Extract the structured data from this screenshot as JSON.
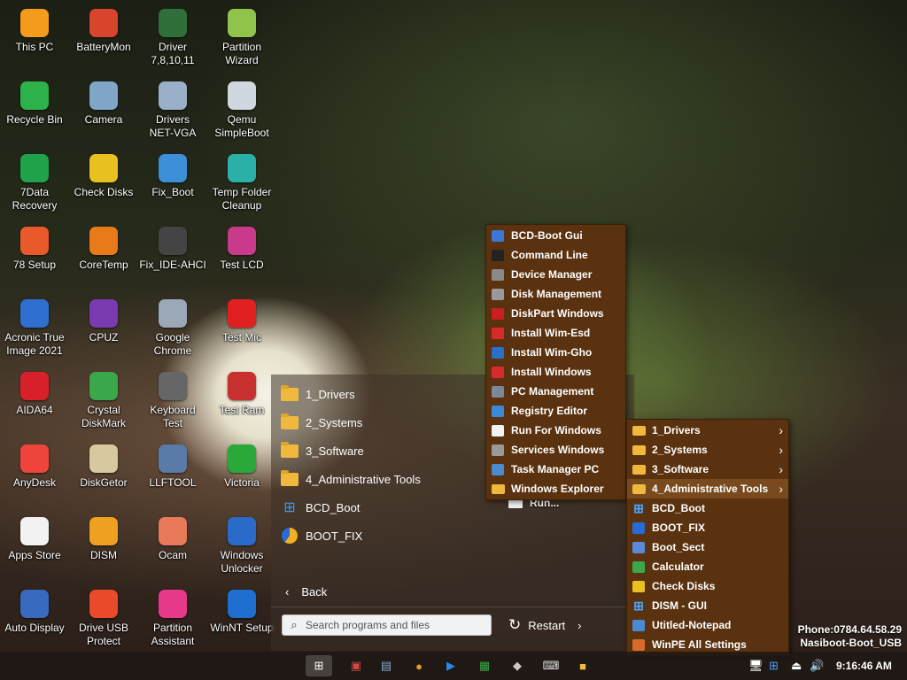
{
  "desktop_icons": [
    {
      "label": "This PC",
      "icon": "this-pc-icon",
      "color": "#f59b1c"
    },
    {
      "label": "BatteryMon",
      "icon": "battery-icon",
      "color": "#d8442c"
    },
    {
      "label": "Driver\n7,8,10,11",
      "icon": "driver-icon",
      "color": "#2f6f3a"
    },
    {
      "label": "Partition\nWizard",
      "icon": "partition-wizard-icon",
      "color": "#8fc34a"
    },
    {
      "label": "Recycle Bin",
      "icon": "recycle-bin-icon",
      "color": "#2db14a"
    },
    {
      "label": "Camera",
      "icon": "camera-icon",
      "color": "#7fa6c8"
    },
    {
      "label": "Drivers\nNET-VGA",
      "icon": "drivers-net-icon",
      "color": "#9ab0c8"
    },
    {
      "label": "Qemu\nSimpleBoot",
      "icon": "qemu-icon",
      "color": "#cfd8e0"
    },
    {
      "label": "7Data\nRecovery",
      "icon": "data-recovery-icon",
      "color": "#1fa24a"
    },
    {
      "label": "Check Disks",
      "icon": "check-disks-icon",
      "color": "#e8c020"
    },
    {
      "label": "Fix_Boot",
      "icon": "fix-boot-icon",
      "color": "#3d8fd8"
    },
    {
      "label": "Temp Folder\nCleanup",
      "icon": "broom-icon",
      "color": "#2bb0a8"
    },
    {
      "label": "78 Setup",
      "icon": "setup-icon",
      "color": "#e85a2a"
    },
    {
      "label": "CoreTemp",
      "icon": "thermometer-icon",
      "color": "#e87a1a"
    },
    {
      "label": "Fix_IDE-AHCI",
      "icon": "ahci-icon",
      "color": "#444444"
    },
    {
      "label": "Test LCD",
      "icon": "lcd-icon",
      "color": "#c83a8a"
    },
    {
      "label": "Acronic True\nImage 2021",
      "icon": "acronis-icon",
      "color": "#2f6fd0"
    },
    {
      "label": "CPUZ",
      "icon": "cpu-icon",
      "color": "#7a3ab0"
    },
    {
      "label": "Google\nChrome",
      "icon": "chrome-icon",
      "color": "#9aa8b8"
    },
    {
      "label": "Test Mic",
      "icon": "microphone-icon",
      "color": "#e02020"
    },
    {
      "label": "AIDA64",
      "icon": "aida64-icon",
      "color": "#d8202a"
    },
    {
      "label": "Crystal\nDiskMark",
      "icon": "diskmark-icon",
      "color": "#3aa84a"
    },
    {
      "label": "Keyboard\nTest",
      "icon": "keyboard-icon",
      "color": "#666666"
    },
    {
      "label": "Test Ram",
      "icon": "ram-icon",
      "color": "#c83030"
    },
    {
      "label": "AnyDesk",
      "icon": "anydesk-icon",
      "color": "#ef443b"
    },
    {
      "label": "DiskGetor",
      "icon": "diskgetor-icon",
      "color": "#d8c8a0"
    },
    {
      "label": "LLFTOOL",
      "icon": "llftool-icon",
      "color": "#5a7aa8"
    },
    {
      "label": "Victoria",
      "icon": "victoria-icon",
      "color": "#2aa83a"
    },
    {
      "label": "Apps Store",
      "icon": "store-icon",
      "color": "#f2f2f2"
    },
    {
      "label": "DISM",
      "icon": "dism-icon",
      "color": "#f0a020"
    },
    {
      "label": "Ocam",
      "icon": "ocam-icon",
      "color": "#e87a5a"
    },
    {
      "label": "Windows\nUnlocker",
      "icon": "unlocker-icon",
      "color": "#2a6ac8"
    },
    {
      "label": "Auto Display",
      "icon": "auto-display-icon",
      "color": "#3a6ac0"
    },
    {
      "label": "Drive USB\nProtect",
      "icon": "usb-protect-icon",
      "color": "#e84a2a"
    },
    {
      "label": "Partition\nAssistant",
      "icon": "partition-assistant-icon",
      "color": "#e83a8a"
    },
    {
      "label": "WinNT Setup",
      "icon": "winnt-setup-icon",
      "color": "#1e6fd0"
    }
  ],
  "start_menu": {
    "items": [
      {
        "label": "1_Drivers",
        "icon": "folder-icon"
      },
      {
        "label": "2_Systems",
        "icon": "folder-icon"
      },
      {
        "label": "3_Software",
        "icon": "folder-icon"
      },
      {
        "label": "4_Administrative Tools",
        "icon": "folder-icon"
      },
      {
        "label": "BCD_Boot",
        "icon": "windows-logo-icon"
      },
      {
        "label": "BOOT_FIX",
        "icon": "pie-chart-icon"
      }
    ],
    "back_label": "Back",
    "search_placeholder": "Search programs and files",
    "restart_label": "Restart"
  },
  "admin_tools_menu": {
    "items": [
      {
        "label": "BCD-Boot Gui",
        "icon": "bcd-gui-icon",
        "color": "#3a78d8"
      },
      {
        "label": "Command Line",
        "icon": "cmd-icon",
        "color": "#222222"
      },
      {
        "label": "Device Manager",
        "icon": "device-manager-icon",
        "color": "#8a8a8a"
      },
      {
        "label": "Disk Management",
        "icon": "disk-management-icon",
        "color": "#9a9a9a"
      },
      {
        "label": "DiskPart Windows",
        "icon": "diskpart-icon",
        "color": "#c82020"
      },
      {
        "label": "Install Wim-Esd",
        "icon": "install-wim-esd-icon",
        "color": "#d82a2a"
      },
      {
        "label": "Install Wim-Gho",
        "icon": "install-wim-gho-icon",
        "color": "#2a70c8"
      },
      {
        "label": "Install Windows",
        "icon": "install-windows-icon",
        "color": "#d82a2a"
      },
      {
        "label": "PC Management",
        "icon": "pc-management-icon",
        "color": "#7a8a9a"
      },
      {
        "label": "Registry Editor",
        "icon": "registry-editor-icon",
        "color": "#3a8ad8"
      },
      {
        "label": "Run For Windows",
        "icon": "run-icon",
        "color": "#f2f2f2"
      },
      {
        "label": "Services Windows",
        "icon": "services-icon",
        "color": "#9a9a9a"
      },
      {
        "label": "Task Manager PC",
        "icon": "task-manager-icon",
        "color": "#4a8ad0"
      },
      {
        "label": "Windows Explorer",
        "icon": "explorer-icon",
        "color": "#f0b93d"
      }
    ],
    "ghost_label": "Run..."
  },
  "programs_menu": {
    "items": [
      {
        "label": "1_Drivers",
        "icon": "folder-icon",
        "submenu": true
      },
      {
        "label": "2_Systems",
        "icon": "folder-icon",
        "submenu": true
      },
      {
        "label": "3_Software",
        "icon": "folder-icon",
        "submenu": true
      },
      {
        "label": "4_Administrative Tools",
        "icon": "folder-icon",
        "submenu": true,
        "selected": true
      },
      {
        "label": "BCD_Boot",
        "icon": "windows-logo-icon"
      },
      {
        "label": "BOOT_FIX",
        "icon": "boot-fix-icon"
      },
      {
        "label": "Boot_Sect",
        "icon": "boot-sect-icon"
      },
      {
        "label": "Calculator",
        "icon": "calculator-icon"
      },
      {
        "label": "Check Disks",
        "icon": "check-disks-icon"
      },
      {
        "label": "DISM - GUI",
        "icon": "dism-gui-icon"
      },
      {
        "label": "Utitled-Notepad",
        "icon": "notepad-icon"
      },
      {
        "label": "WinPE All Settings",
        "icon": "settings-tools-icon"
      }
    ]
  },
  "watermark": {
    "phone": "Phone:0784.64.58.29",
    "name": "Nasiboot-Boot_USB"
  },
  "taskbar": {
    "clock": "9:16:46 AM",
    "apps": [
      "start-button-icon",
      "network-tool-icon",
      "disk-tool-icon",
      "chrome-icon",
      "media-player-icon",
      "install-icon",
      "ahci-tool-icon",
      "keyboard-icon",
      "explorer-icon"
    ],
    "tray": [
      "network-icon",
      "windows-flag-icon",
      "usb-eject-icon",
      "volume-icon"
    ]
  }
}
